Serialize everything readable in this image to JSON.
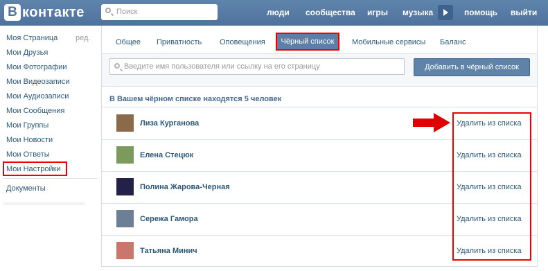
{
  "header": {
    "logo_letter": "В",
    "logo_text": "контакте",
    "search_placeholder": "Поиск",
    "nav": [
      "люди",
      "сообщества",
      "игры",
      "музыка",
      "помощь",
      "выйти"
    ]
  },
  "left_menu": {
    "items": [
      "Моя Страница",
      "Мои Друзья",
      "Мои Фотографии",
      "Мои Видеозаписи",
      "Мои Аудиозаписи",
      "Мои Сообщения",
      "Мои Группы",
      "Мои Новости",
      "Мои Ответы",
      "Мои Настройки"
    ],
    "edit_label": "ред.",
    "documents": "Документы"
  },
  "tabs": [
    "Общее",
    "Приватность",
    "Оповещения",
    "Чёрный список",
    "Мобильные сервисы",
    "Баланс"
  ],
  "active_tab_index": 3,
  "blacklist": {
    "input_placeholder": "Введите имя пользователя или ссылку на его страницу",
    "add_button": "Добавить в чёрный список",
    "summary": "В Вашем чёрном списке находятся 5 человек",
    "remove_label": "Удалить из списка",
    "users": [
      {
        "name": "Лиза Курганова",
        "avatar_color": "#8a6a4a"
      },
      {
        "name": "Елена Стецюк",
        "avatar_color": "#7c9a5c"
      },
      {
        "name": "Полина Жарова-Черная",
        "avatar_color": "#23204a"
      },
      {
        "name": "Сережа Гамора",
        "avatar_color": "#6d7f94"
      },
      {
        "name": "Татьяна Минич",
        "avatar_color": "#c9766d"
      }
    ]
  },
  "colors": {
    "header_bg": "#5b7fa6",
    "link": "#2b587a",
    "highlight": "#e00000"
  }
}
